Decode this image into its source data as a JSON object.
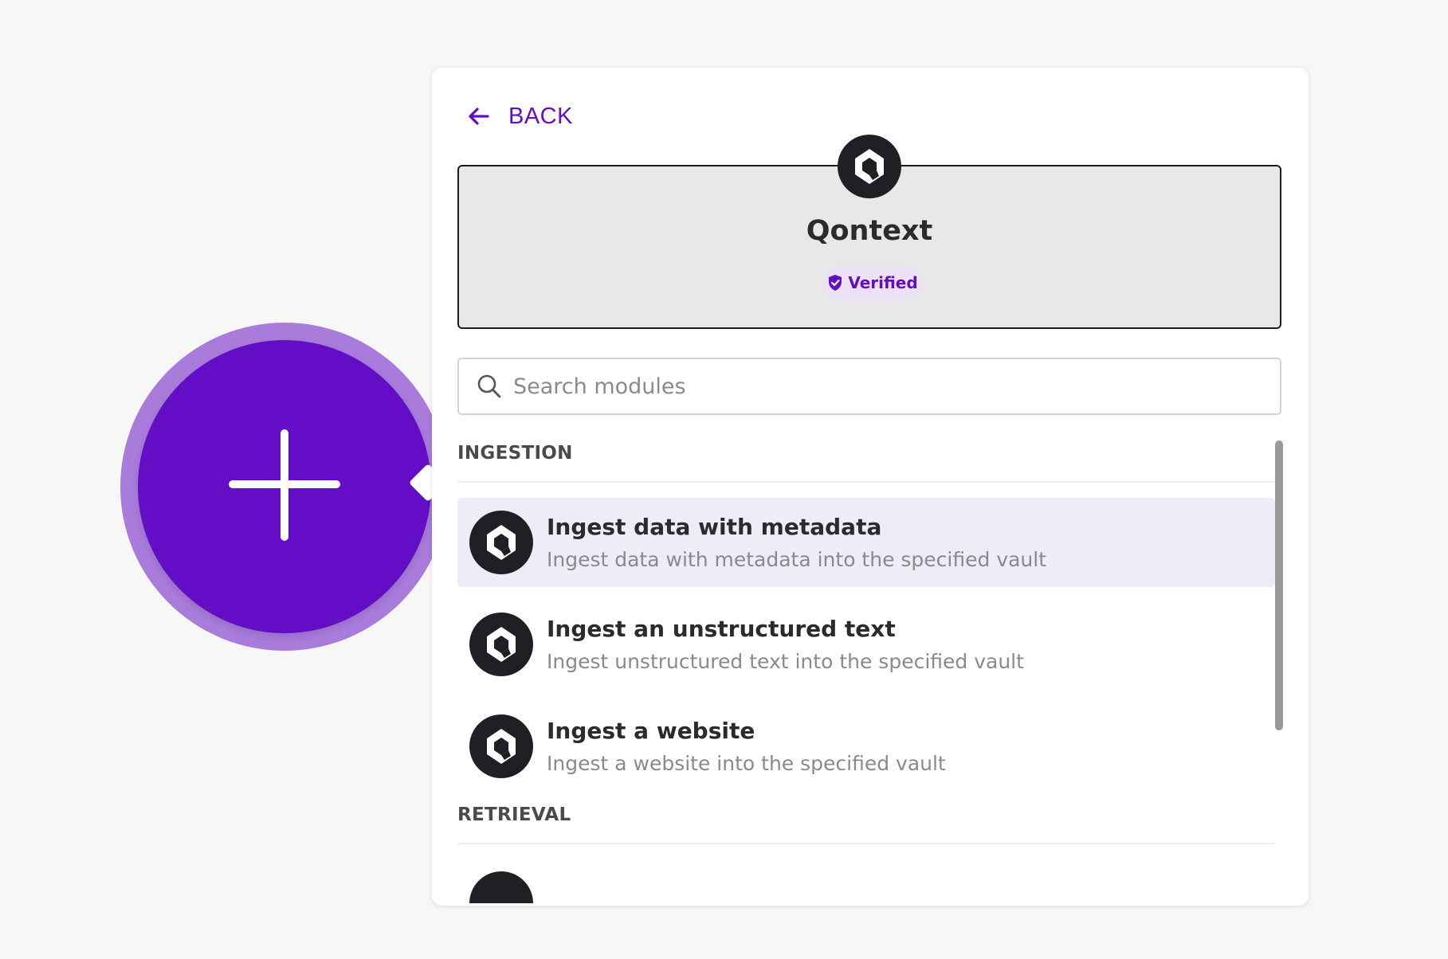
{
  "header": {
    "back_label": "BACK",
    "back_icon": "arrow-left-icon",
    "accent_color": "#630dc6"
  },
  "app": {
    "name": "Qontext",
    "badge": "Verified",
    "logo_icon": "qontext-logo-icon"
  },
  "search": {
    "placeholder": "Search modules",
    "value": ""
  },
  "sections": [
    {
      "title": "INGESTION",
      "modules": [
        {
          "title": "Ingest data with metadata",
          "description": "Ingest data with metadata into the specified vault",
          "highlighted": true
        },
        {
          "title": "Ingest an unstructured text",
          "description": "Ingest unstructured text into the specified vault",
          "highlighted": false
        },
        {
          "title": "Ingest a website",
          "description": "Ingest a website into the specified vault",
          "highlighted": false
        }
      ]
    },
    {
      "title": "RETRIEVAL",
      "modules": []
    }
  ],
  "add_button": {
    "icon": "plus-icon",
    "color": "#630dc6",
    "ring_color": "#a97cdc"
  }
}
